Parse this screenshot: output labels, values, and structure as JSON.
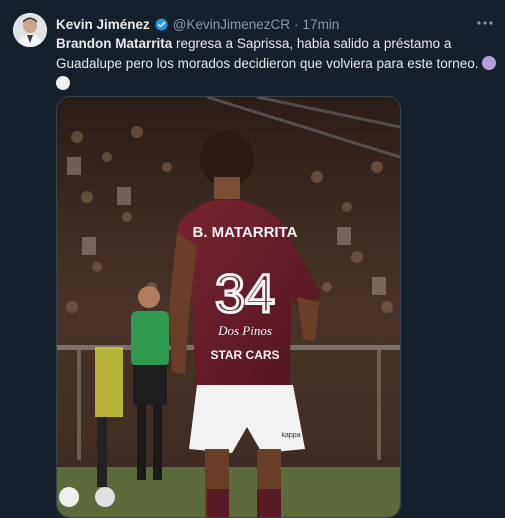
{
  "author": {
    "name": "Kevin Jiménez",
    "handle": "@KevinJimenezCR",
    "separator": "·",
    "time": "17min",
    "verified": true
  },
  "tweet": {
    "bold_name": "Brandon Matarrita",
    "text_part1": " regresa a Saprissa, habia salido a préstamo a Guadalupe pero los morados decidieron que volviera para este torneo.",
    "emojis": [
      "purple-circle",
      "white-circle"
    ]
  },
  "media": {
    "jersey_name": "B. MATARRITA",
    "jersey_number": "34",
    "sponsor_1": "Dos Pinos",
    "sponsor_2": "STAR CARS",
    "kit_brand": "kappa"
  },
  "colors": {
    "background": "#15202b",
    "text": "#e7e9ea",
    "secondary": "#8b98a5",
    "verified": "#1d9bf0",
    "jersey": "#6b1f2c"
  },
  "icons": [
    "verified-badge-icon",
    "more-options-icon"
  ]
}
